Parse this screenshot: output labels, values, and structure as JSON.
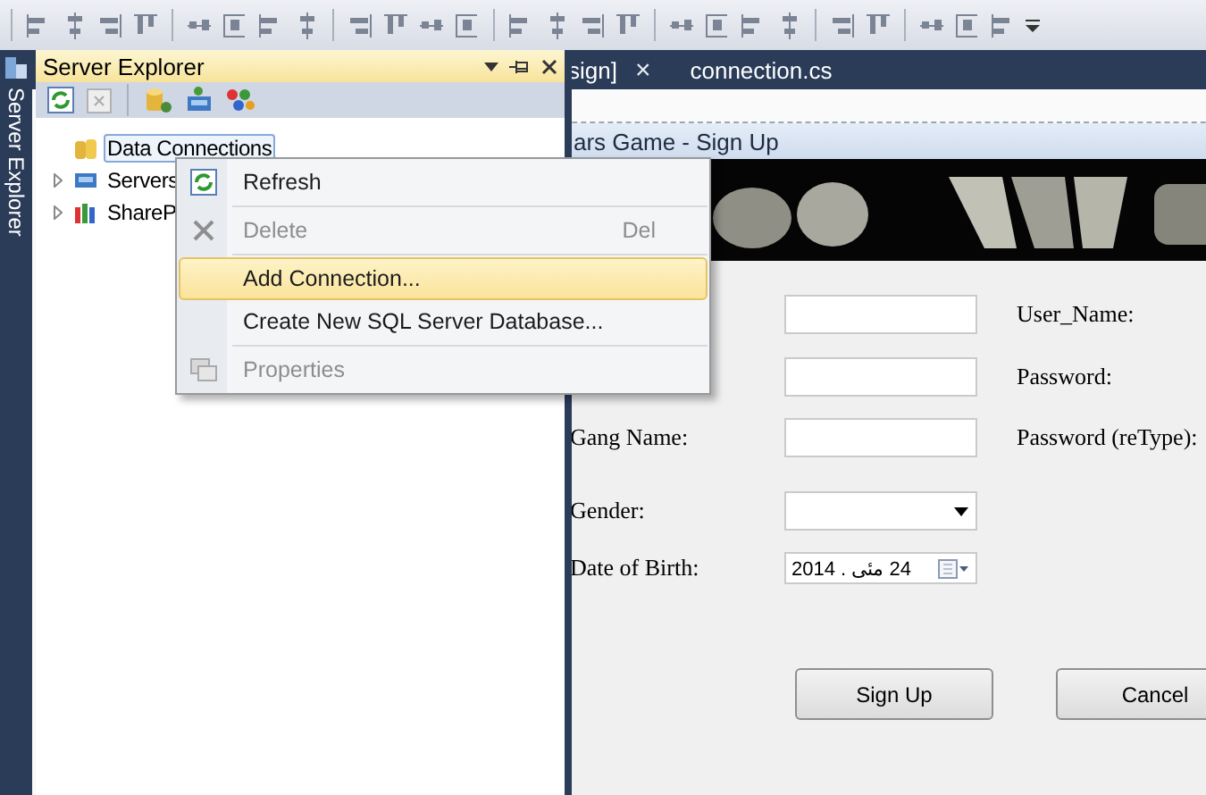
{
  "side_tab": {
    "label": "Server Explorer"
  },
  "document_tabs": [
    {
      "label": "sign]",
      "close": "×"
    },
    {
      "label": "connection.cs"
    }
  ],
  "server_explorer": {
    "title": "Server Explorer",
    "tree": [
      {
        "label": "Data Connections",
        "selected": true,
        "expandable": false
      },
      {
        "label": "Servers",
        "selected": false,
        "expandable": true
      },
      {
        "label": "ShareP",
        "selected": false,
        "expandable": true
      }
    ]
  },
  "context_menu": [
    {
      "kind": "refresh",
      "label": "Refresh",
      "disabled": false,
      "highlighted": false,
      "separator_after": true
    },
    {
      "kind": "delete",
      "label": "Delete",
      "shortcut": "Del",
      "disabled": true,
      "highlighted": false,
      "separator_after": true
    },
    {
      "kind": "plain",
      "label": "Add Connection...",
      "disabled": false,
      "highlighted": true,
      "separator_after": false
    },
    {
      "kind": "plain",
      "label": "Create New SQL Server Database...",
      "disabled": false,
      "highlighted": false,
      "separator_after": true
    },
    {
      "kind": "properties",
      "label": "Properties",
      "disabled": true,
      "highlighted": false,
      "separator_after": false
    }
  ],
  "form": {
    "title": "ars Game - Sign Up",
    "rows": [
      {
        "input": {
          "kind": "text"
        },
        "right_label": "User_Name:"
      },
      {
        "input": {
          "kind": "text"
        },
        "right_label": "Password:"
      },
      {
        "left_label": "Gang Name:",
        "input": {
          "kind": "text"
        },
        "right_label": "Password (reType):"
      },
      {
        "left_label": "Gender:",
        "input": {
          "kind": "combo"
        }
      },
      {
        "left_label": "Date of Birth:",
        "input": {
          "kind": "date",
          "value": "24 مئی . 2014"
        }
      }
    ],
    "buttons": [
      "Sign Up",
      "Cancel"
    ]
  }
}
